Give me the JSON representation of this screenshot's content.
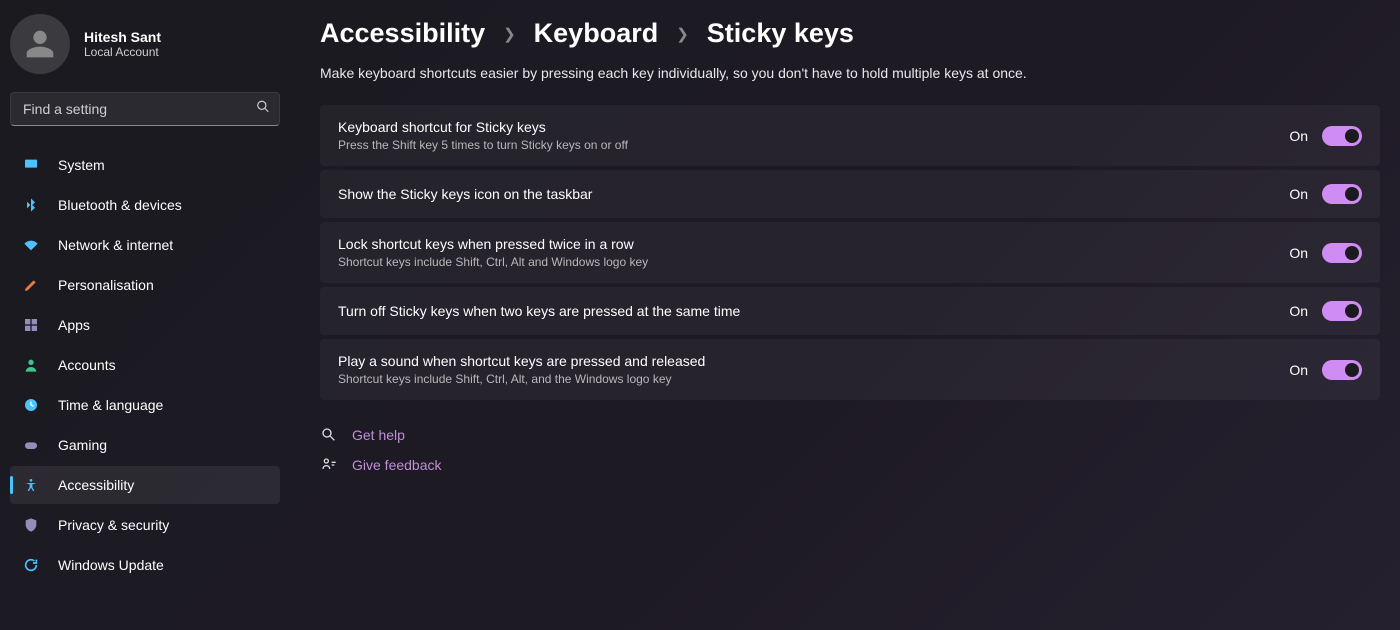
{
  "profile": {
    "name": "Hitesh Sant",
    "type": "Local Account"
  },
  "search": {
    "placeholder": "Find a setting"
  },
  "sidebar": {
    "items": [
      {
        "label": "System"
      },
      {
        "label": "Bluetooth & devices"
      },
      {
        "label": "Network & internet"
      },
      {
        "label": "Personalisation"
      },
      {
        "label": "Apps"
      },
      {
        "label": "Accounts"
      },
      {
        "label": "Time & language"
      },
      {
        "label": "Gaming"
      },
      {
        "label": "Accessibility"
      },
      {
        "label": "Privacy & security"
      },
      {
        "label": "Windows Update"
      }
    ]
  },
  "breadcrumb": {
    "c0": "Accessibility",
    "c1": "Keyboard",
    "c2": "Sticky keys"
  },
  "description": "Make keyboard shortcuts easier by pressing each key individually, so you don't have to hold multiple keys at once.",
  "settings": [
    {
      "title": "Keyboard shortcut for Sticky keys",
      "subtitle": "Press the Shift key 5 times to turn Sticky keys on or off",
      "state": "On"
    },
    {
      "title": "Show the Sticky keys icon on the taskbar",
      "subtitle": "",
      "state": "On"
    },
    {
      "title": "Lock shortcut keys when pressed twice in a row",
      "subtitle": "Shortcut keys include Shift, Ctrl, Alt and Windows logo key",
      "state": "On"
    },
    {
      "title": "Turn off Sticky keys when two keys are pressed at the same time",
      "subtitle": "",
      "state": "On"
    },
    {
      "title": "Play a sound when shortcut keys are pressed and released",
      "subtitle": "Shortcut keys include Shift, Ctrl, Alt, and the Windows logo key",
      "state": "On"
    }
  ],
  "links": {
    "help": "Get help",
    "feedback": "Give feedback"
  }
}
